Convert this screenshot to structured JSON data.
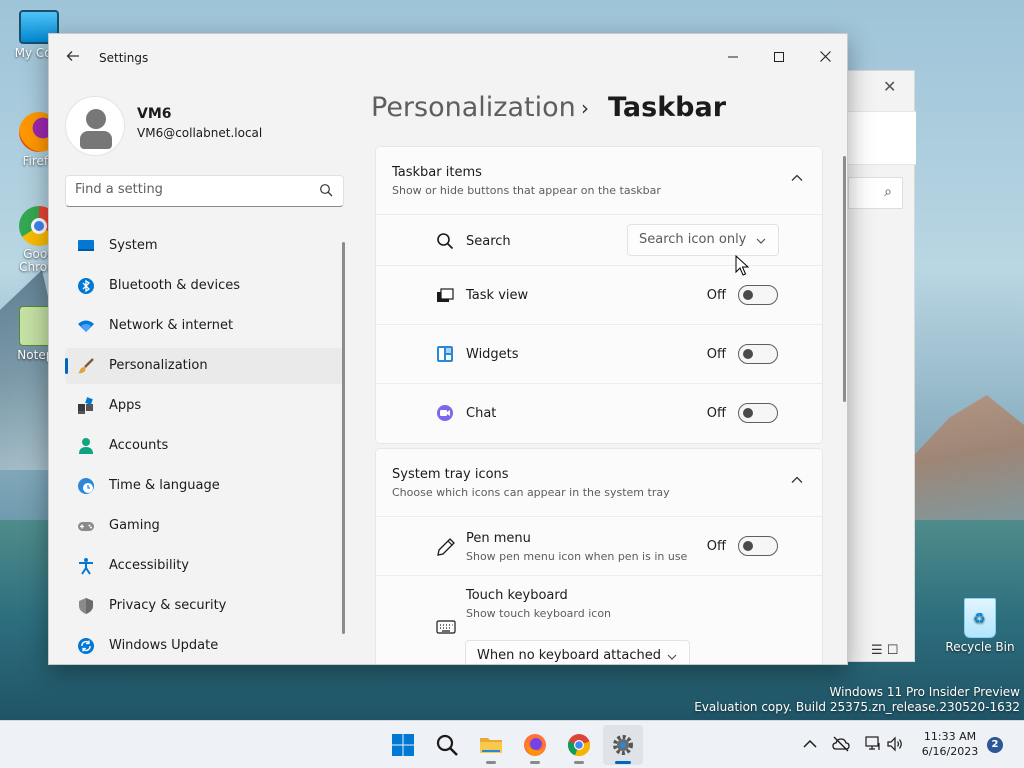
{
  "desktop": {
    "icons": [
      {
        "label": "My Com"
      },
      {
        "label": "Firefo"
      },
      {
        "label": "Goog\nChrom"
      },
      {
        "label": "Notepa"
      },
      {
        "label": "Recycle Bin"
      }
    ],
    "watermark": {
      "line1": "Windows 11 Pro Insider Preview",
      "line2": "Evaluation copy. Build 25375.zn_release.230520-1632"
    }
  },
  "window": {
    "title": "Settings",
    "minimize": "–",
    "maximize": "☐",
    "close": "✕"
  },
  "profile": {
    "name": "VM6",
    "email": "VM6@collabnet.local"
  },
  "search": {
    "placeholder": "Find a setting"
  },
  "nav": {
    "items": [
      {
        "label": "System"
      },
      {
        "label": "Bluetooth & devices"
      },
      {
        "label": "Network & internet"
      },
      {
        "label": "Personalization",
        "selected": true
      },
      {
        "label": "Apps"
      },
      {
        "label": "Accounts"
      },
      {
        "label": "Time & language"
      },
      {
        "label": "Gaming"
      },
      {
        "label": "Accessibility"
      },
      {
        "label": "Privacy & security"
      },
      {
        "label": "Windows Update"
      }
    ]
  },
  "breadcrumb": {
    "parent": "Personalization",
    "separator": "›",
    "current": "Taskbar"
  },
  "taskbar_items": {
    "title": "Taskbar items",
    "description": "Show or hide buttons that appear on the taskbar",
    "search": {
      "label": "Search",
      "value": "Search icon only"
    },
    "task_view": {
      "label": "Task view",
      "state": "Off"
    },
    "widgets": {
      "label": "Widgets",
      "state": "Off"
    },
    "chat": {
      "label": "Chat",
      "state": "Off"
    }
  },
  "system_tray": {
    "title": "System tray icons",
    "description": "Choose which icons can appear in the system tray",
    "pen_menu": {
      "label": "Pen menu",
      "description": "Show pen menu icon when pen is in use",
      "state": "Off"
    },
    "touch_keyboard": {
      "label": "Touch keyboard",
      "description": "Show touch keyboard icon",
      "value": "When no keyboard attached"
    }
  },
  "clock": {
    "time": "11:33 AM",
    "date": "6/16/2023"
  },
  "notifications": {
    "count": "2"
  }
}
